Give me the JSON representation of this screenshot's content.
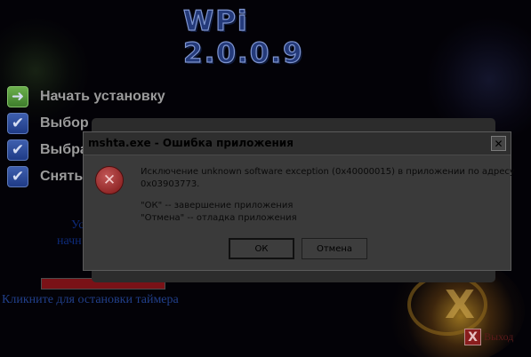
{
  "app": {
    "title": "WPi 2.0.0.9"
  },
  "menu": {
    "items": [
      {
        "label": "Начать установку",
        "icon": "arrow-right-icon"
      },
      {
        "label": "Выбор по умолчанию",
        "icon": "checkbox-icon"
      },
      {
        "label": "Выбрать",
        "icon": "checkbox-icon"
      },
      {
        "label": "Снять",
        "icon": "checkbox-icon"
      }
    ]
  },
  "partial_text": {
    "line1": "Ус",
    "line2": "начн"
  },
  "timer": {
    "link": "Кликните для остановки таймера"
  },
  "exit": {
    "label": "Выход"
  },
  "dialog": {
    "title": "mshta.exe - Ошибка приложения",
    "message_line1": "Исключение unknown software exception (0x40000015) в приложении по адресу",
    "message_line2": "0x03903773.",
    "hint_ok": "\"ОК\" -- завершение приложения",
    "hint_cancel": "\"Отмена\" -- отладка приложения",
    "ok_label": "ОК",
    "cancel_label": "Отмена",
    "close_glyph": "✕"
  },
  "colors": {
    "background": "#030207",
    "progress_fill": "#7a1217",
    "dialog_bg": "#3a3a3a",
    "link": "#213f8a"
  }
}
